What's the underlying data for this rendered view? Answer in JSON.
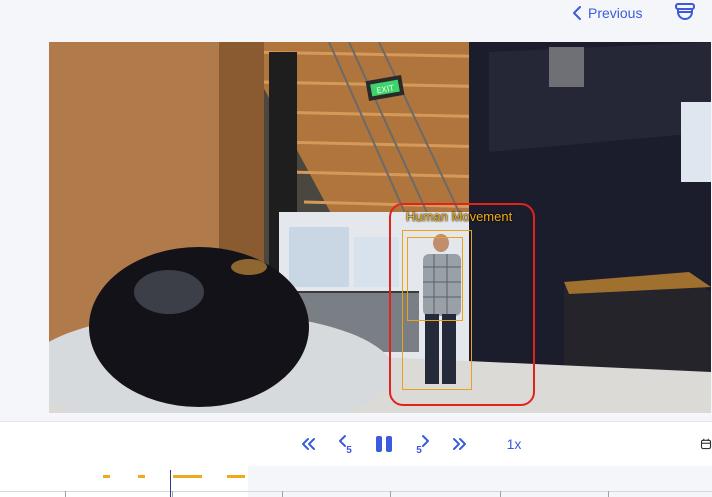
{
  "header": {
    "previous_label": "Previous",
    "previous_icon": "chevron-left-icon",
    "camera_icon": "camera-dome-icon"
  },
  "video": {
    "detection_label": "Human Movement",
    "scene_exit_sign": "EXIT"
  },
  "controls": {
    "rewind_icon": "double-chevron-left-icon",
    "back_5_icon": "skip-back-5-icon",
    "back_5_label": "5",
    "pause_icon": "pause-icon",
    "forward_5_icon": "skip-forward-5-icon",
    "forward_5_label": "5",
    "fast_forward_icon": "double-chevron-right-icon",
    "speed": "1x",
    "calendar_icon": "calendar-icon"
  },
  "colors": {
    "accent": "#3b5bdb",
    "detection": "#e8a317",
    "highlight": "#e0241b",
    "timeline_event": "#f0a81c"
  }
}
